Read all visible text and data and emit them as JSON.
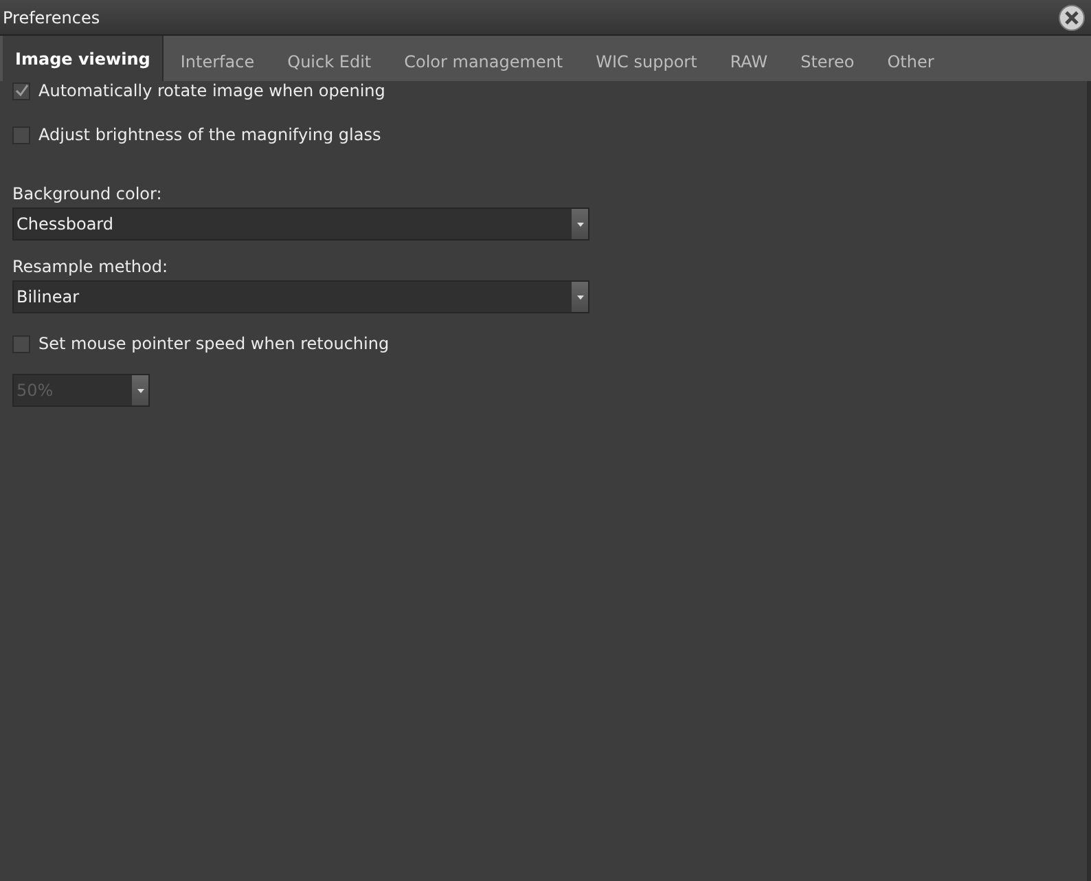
{
  "window": {
    "title": "Preferences"
  },
  "tabs": [
    {
      "label": "Image viewing",
      "selected": true
    },
    {
      "label": "Interface",
      "selected": false
    },
    {
      "label": "Quick Edit",
      "selected": false
    },
    {
      "label": "Color management",
      "selected": false
    },
    {
      "label": "WIC support",
      "selected": false
    },
    {
      "label": "RAW",
      "selected": false
    },
    {
      "label": "Stereo",
      "selected": false
    },
    {
      "label": "Other",
      "selected": false
    }
  ],
  "sections": [
    {
      "items": [
        {
          "kind": "checkbox",
          "label": "Automatically rotate image when opening",
          "checked": true
        },
        {
          "kind": "checkbox",
          "label": "Adjust brightness of the magnifying glass",
          "checked": false
        }
      ]
    },
    {
      "items": [
        {
          "kind": "dropdown",
          "label": "Background color:",
          "value": "Chessboard",
          "disabled": false
        },
        {
          "kind": "dropdown",
          "label": "Resample method:",
          "value": "Bilinear",
          "disabled": false
        },
        {
          "kind": "checkbox",
          "label": "Set mouse pointer speed when retouching",
          "checked": false
        },
        {
          "kind": "dropdown",
          "value": "50%",
          "disabled": true
        }
      ]
    }
  ]
}
